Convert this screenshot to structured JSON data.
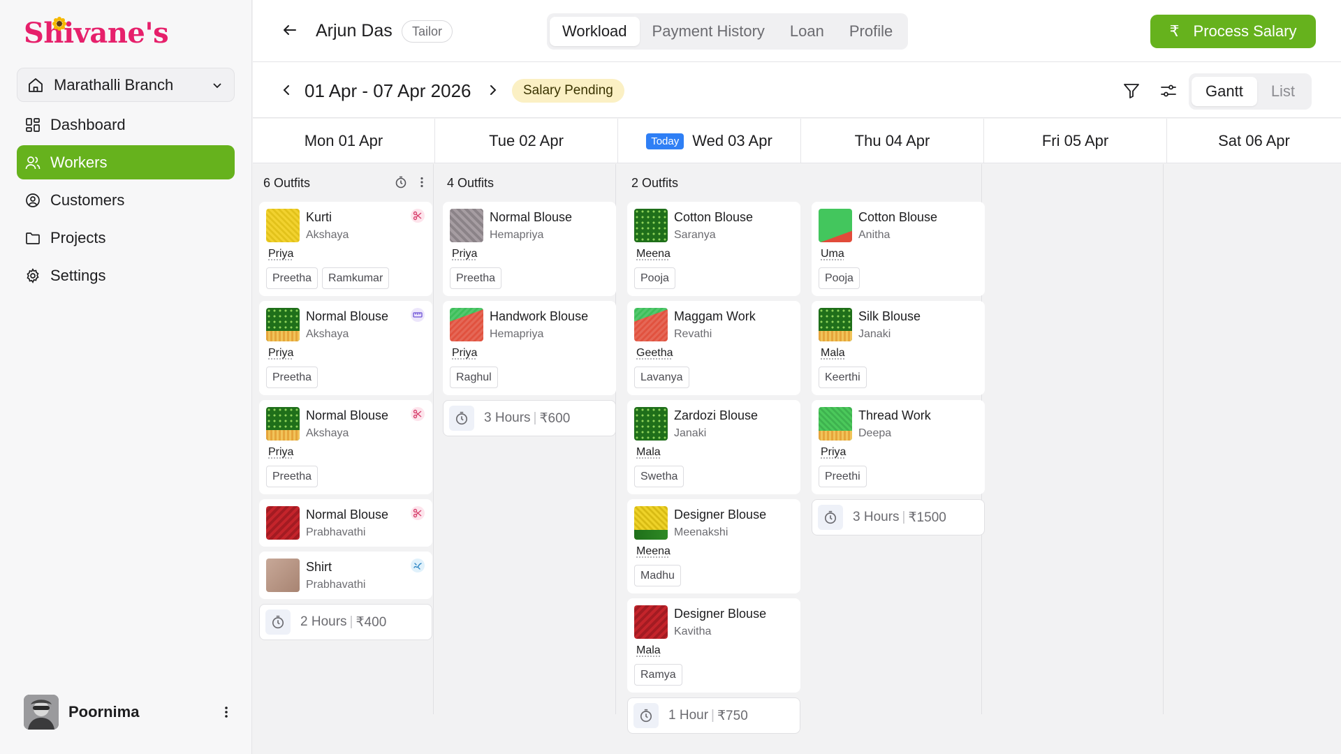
{
  "app": {
    "brand": "Shivane's",
    "branch": "Marathalli Branch",
    "nav": [
      {
        "label": "Dashboard",
        "icon": "dashboard-icon"
      },
      {
        "label": "Workers",
        "icon": "users-icon"
      },
      {
        "label": "Customers",
        "icon": "customer-icon"
      },
      {
        "label": "Projects",
        "icon": "folder-icon"
      },
      {
        "label": "Settings",
        "icon": "gear-icon"
      }
    ],
    "active_nav": "Workers",
    "user": "Poornima",
    "accent": "#66b21d",
    "brand_color": "#e6206b"
  },
  "header": {
    "worker_name": "Arjun Das",
    "role": "Tailor",
    "tabs": [
      "Workload",
      "Payment History",
      "Loan",
      "Profile"
    ],
    "active_tab": "Workload",
    "process_button": "Process Salary",
    "rupee_symbol": "₹"
  },
  "toolbar": {
    "date_range": "01 Apr - 07 Apr 2026",
    "status": "Salary Pending",
    "views": [
      "Gantt",
      "List"
    ],
    "active_view": "Gantt"
  },
  "calendar": {
    "today_label": "Today",
    "days": [
      "Mon 01 Apr",
      "Tue 02 Apr",
      "Wed 03 Apr",
      "Thu 04 Apr",
      "Fri 05 Apr",
      "Sat 06 Apr"
    ],
    "columns": [
      {
        "count": "6 Outfits",
        "cards": [
          {
            "title": "Kurti",
            "customer": "Akshaya",
            "assigned": "Priya",
            "tags": [
              "Preetha",
              "Ramkumar"
            ],
            "status_icon": "scissors-icon"
          },
          {
            "title": "Normal Blouse",
            "customer": "Akshaya",
            "assigned": "Priya",
            "tags": [
              "Preetha"
            ],
            "status_icon": "measure-icon"
          },
          {
            "title": "Normal Blouse",
            "customer": "Akshaya",
            "assigned": "Priya",
            "tags": [
              "Preetha"
            ],
            "status_icon": "scissors-icon"
          },
          {
            "title": "Normal Blouse",
            "customer": "Prabhavathi",
            "assigned": "",
            "tags": [],
            "status_icon": "scissors-icon"
          },
          {
            "title": "Shirt",
            "customer": "Prabhavathi",
            "assigned": "",
            "tags": [],
            "status_icon": "stitch-icon"
          }
        ],
        "summary_hours": "2 Hours",
        "summary_amount": "₹400"
      },
      {
        "count": "4 Outfits",
        "cards": [
          {
            "title": "Normal Blouse",
            "customer": "Hemapriya",
            "assigned": "Priya",
            "tags": [
              "Preetha"
            ]
          },
          {
            "title": "Handwork Blouse",
            "customer": "Hemapriya",
            "assigned": "Priya",
            "tags": [
              "Raghul"
            ]
          }
        ],
        "summary_hours": "3 Hours",
        "summary_amount": "₹600"
      },
      {
        "count": "2 Outfits",
        "cards": [
          {
            "title": "Cotton Blouse",
            "customer": "Saranya",
            "assigned": "Meena",
            "tags": [
              "Pooja"
            ]
          },
          {
            "title": "Maggam Work",
            "customer": "Revathi",
            "assigned": "Geetha",
            "tags": [
              "Lavanya"
            ]
          },
          {
            "title": "Zardozi Blouse",
            "customer": "Janaki",
            "assigned": "Mala",
            "tags": [
              "Swetha"
            ]
          },
          {
            "title": "Designer Blouse",
            "customer": "Meenakshi",
            "assigned": "Meena",
            "tags": [
              "Madhu"
            ]
          },
          {
            "title": "Designer Blouse",
            "customer": "Kavitha",
            "assigned": "Mala",
            "tags": [
              "Ramya"
            ]
          }
        ],
        "summary_hours": "1 Hour",
        "summary_amount": "₹750"
      },
      {
        "count": "",
        "cards": [
          {
            "title": "Cotton Blouse",
            "customer": "Anitha",
            "assigned": "Uma",
            "tags": [
              "Pooja"
            ]
          },
          {
            "title": "Silk Blouse",
            "customer": "Janaki",
            "assigned": "Mala",
            "tags": [
              "Keerthi"
            ]
          },
          {
            "title": "Thread Work",
            "customer": "Deepa",
            "assigned": "Priya",
            "tags": [
              "Preethi"
            ]
          }
        ],
        "summary_hours": "3 Hours",
        "summary_amount": "₹1500"
      }
    ]
  }
}
